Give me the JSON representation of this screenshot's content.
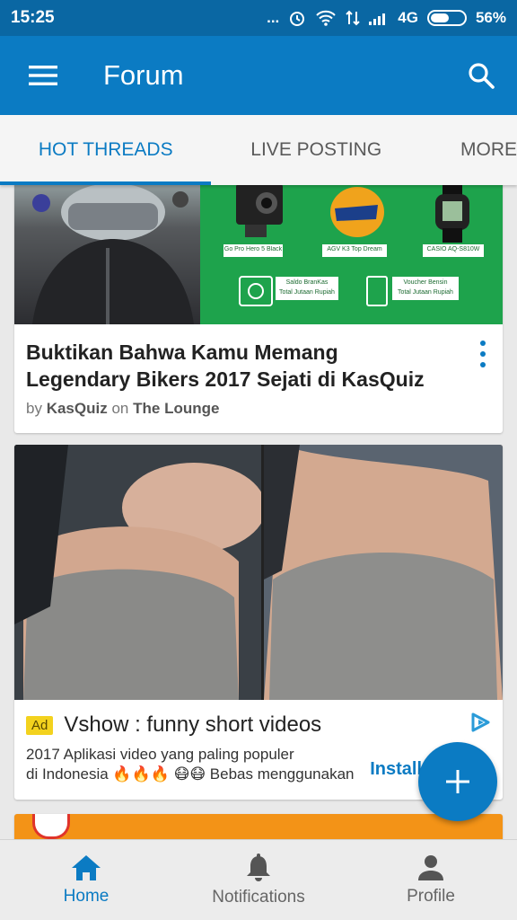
{
  "status_bar": {
    "time": "15:25",
    "dots": "...",
    "network": "4G",
    "battery": "56%",
    "battery_level": 0.56
  },
  "app_bar": {
    "title": "Forum"
  },
  "tabs": [
    {
      "label": "HOT THREADS",
      "active": true
    },
    {
      "label": "LIVE POSTING",
      "active": false
    },
    {
      "label": "MORE",
      "active": false
    }
  ],
  "thread": {
    "title_line1": "Buktikan Bahwa Kamu Memang",
    "title_line2": "Legendary Bikers 2017 Sejati di KasQuiz",
    "by": "by",
    "author": "KasQuiz",
    "on": "on",
    "forum": "The Lounge",
    "promo": {
      "prize1": "Go Pro Hero 5 Black",
      "prize2": "AGV K3 Top Dream",
      "prize3": "CASIO AQ-S810W",
      "prize4_line1": "Saldo BranKas",
      "prize4_line2": "Total Jutaan Rupiah",
      "prize5_line1": "Voucher Bensin",
      "prize5_line2": "Total Jutaan Rupiah"
    }
  },
  "ad": {
    "badge": "Ad",
    "title": "Vshow : funny short videos",
    "desc_line1": "2017 Aplikasi video yang paling populer",
    "desc_line2": "di Indonesia 🔥🔥🔥 😷😷 Bebas menggunakan",
    "install_label": "Install"
  },
  "bottom_nav": [
    {
      "label": "Home",
      "icon": "home-icon",
      "active": true
    },
    {
      "label": "Notifications",
      "icon": "bell-icon",
      "active": false
    },
    {
      "label": "Profile",
      "icon": "person-icon",
      "active": false
    }
  ],
  "colors": {
    "primary": "#0b7bc3",
    "status_bar": "#0a67a3",
    "ad_badge": "#f3d21e",
    "promo_green": "#1ea34c"
  }
}
